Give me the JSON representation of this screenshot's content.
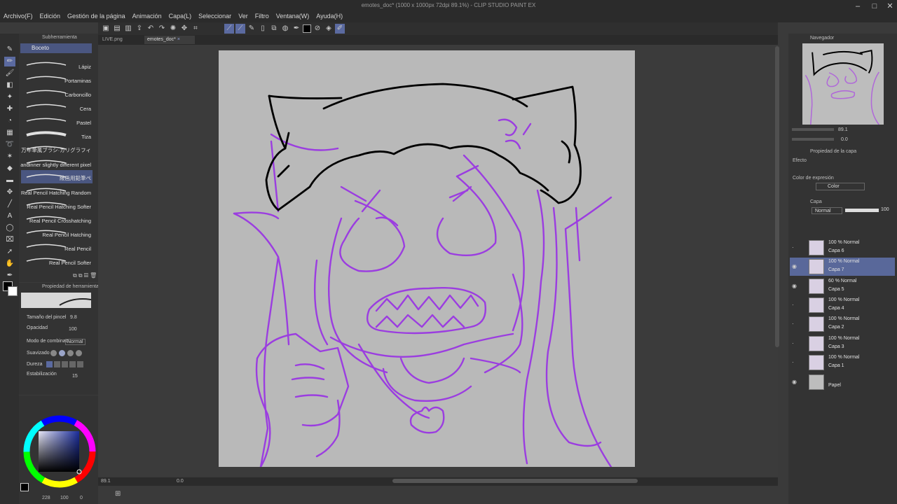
{
  "window": {
    "title": "emotes_doc* (1000 x 1000px 72dpi 89.1%) - CLIP STUDIO PAINT EX"
  },
  "menu": [
    "Archivo(F)",
    "Edición",
    "Gestión de la página",
    "Animación",
    "Capa(L)",
    "Seleccionar",
    "Ver",
    "Filtro",
    "Ventana(W)",
    "Ayuda(H)"
  ],
  "tabs": [
    {
      "label": "LIVE.png"
    },
    {
      "label": "emotes_doc*"
    }
  ],
  "subtool": {
    "header": "Subherramienta",
    "group": "Boceto",
    "brushes": [
      {
        "label": "Lápiz"
      },
      {
        "label": "Portaminas"
      },
      {
        "label": "Carboncillo"
      },
      {
        "label": "Cera"
      },
      {
        "label": "Pastel"
      },
      {
        "label": "Tiza"
      },
      {
        "label": "万年筆風ブラシ·カリグラフィ"
      },
      {
        "label": "andinner slightly different pixel"
      },
      {
        "label": "綾画用鉛筆ぺ"
      },
      {
        "label": "Real Pencil Hatching Random"
      },
      {
        "label": "Real Pencil Hatching Softer"
      },
      {
        "label": "Real Pencil Crosshatching"
      },
      {
        "label": "Real Pencil Hatching"
      },
      {
        "label": "Real Pencil"
      },
      {
        "label": "Real Pencil Softer"
      }
    ]
  },
  "toolprop": {
    "header": "Propiedad de herramienta",
    "brush_size_label": "Tamaño del pincel",
    "brush_size_value": "9.8",
    "opacity_label": "Opacidad",
    "opacity_value": "100",
    "blend_label": "Modo de combinac.",
    "blend_value": "Normal",
    "smooth_label": "Suavizado",
    "hardness_label": "Dureza",
    "stab_label": "Estabilización",
    "stab_value": "15"
  },
  "color": {
    "foreground": "#000000",
    "background": "#ffffff",
    "rgb_readout": "228",
    "v1": "100",
    "v2": "0"
  },
  "navigator": {
    "header": "Navegador",
    "zoom": "89.1",
    "rotation": "0.0"
  },
  "layerprop": {
    "header": "Propiedad de la capa",
    "effect_label": "Efecto",
    "expression_label": "Color de expresión",
    "expression_value": "Color"
  },
  "layers_panel": {
    "header": "Capa",
    "blend": "Normal",
    "opacity": "100",
    "layers": [
      {
        "mode": "100 % Normal",
        "name": "Capa 6",
        "visible": false,
        "selected": false
      },
      {
        "mode": "100 % Normal",
        "name": "Capa 7",
        "visible": true,
        "selected": true
      },
      {
        "mode": "60 % Normal",
        "name": "Capa 5",
        "visible": true,
        "selected": false
      },
      {
        "mode": "100 % Normal",
        "name": "Capa 4",
        "visible": false,
        "selected": false
      },
      {
        "mode": "100 % Normal",
        "name": "Capa 2",
        "visible": false,
        "selected": false
      },
      {
        "mode": "100 % Normal",
        "name": "Capa 3",
        "visible": false,
        "selected": false
      },
      {
        "mode": "100 % Normal",
        "name": "Capa 1",
        "visible": false,
        "selected": false
      },
      {
        "mode": "",
        "name": "Papel",
        "visible": true,
        "selected": false
      }
    ]
  },
  "status": {
    "zoom": "89.1",
    "angle": "0.0"
  },
  "colors": {
    "accent": "#5b6aa0",
    "sketch_purple": "#9b3de0",
    "ink": "#000000"
  }
}
